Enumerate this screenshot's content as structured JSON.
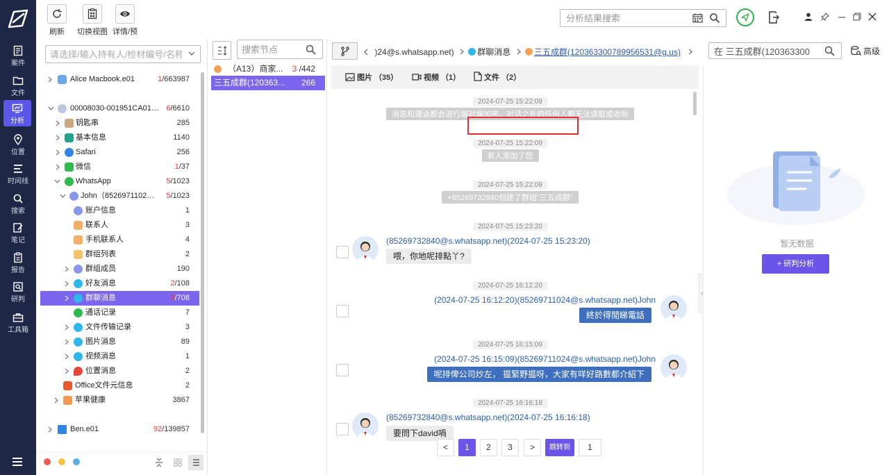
{
  "rail": {
    "items": [
      {
        "label": "案件"
      },
      {
        "label": "文件"
      },
      {
        "label": "分析"
      },
      {
        "label": "位置"
      },
      {
        "label": "时间线"
      },
      {
        "label": "搜索"
      },
      {
        "label": "笔记"
      },
      {
        "label": "报告"
      },
      {
        "label": "研判"
      },
      {
        "label": "工具箱"
      }
    ],
    "active_index": 2
  },
  "toolbar": {
    "refresh_label": "刷新",
    "switch_view_label": "切换视图",
    "details_label": "详情/预览",
    "search_placeholder": "分析结果搜索"
  },
  "tree": {
    "search_placeholder": "请选择/输入持有人/检材编号/名称",
    "rows": [
      {
        "label": "Alice Macbook.e01",
        "cnt_red": "1",
        "cnt": "/663987"
      },
      {
        "label": "00008030-001951CA0130...",
        "cnt_red": "6",
        "cnt": "/6610"
      },
      {
        "label": "钥匙串",
        "cnt": "285"
      },
      {
        "label": "基本信息",
        "cnt": "1140"
      },
      {
        "label": "Safari",
        "cnt": "256"
      },
      {
        "label": "微信",
        "cnt_red": "1",
        "cnt": "/37"
      },
      {
        "label": "WhatsApp",
        "cnt_red": "5",
        "cnt": "/1023"
      },
      {
        "label": "John（85269711024...",
        "cnt_red": "5",
        "cnt": "/1023"
      },
      {
        "label": "账户信息",
        "cnt": "1"
      },
      {
        "label": "联系人",
        "cnt": "3"
      },
      {
        "label": "手机联系人",
        "cnt": "4"
      },
      {
        "label": "群组列表",
        "cnt": "2"
      },
      {
        "label": "群组成员",
        "cnt": "190"
      },
      {
        "label": "好友消息",
        "cnt_red": "2",
        "cnt": "/108"
      },
      {
        "label": "群聊消息",
        "cnt_red": "3",
        "cnt": "/708"
      },
      {
        "label": "通话记录",
        "cnt": "7"
      },
      {
        "label": "文件传输记录",
        "cnt": "3"
      },
      {
        "label": "图片消息",
        "cnt": "89"
      },
      {
        "label": "视频消息",
        "cnt": "1"
      },
      {
        "label": "位置消息",
        "cnt": "2"
      },
      {
        "label": "Office文件元信息",
        "cnt": "2"
      },
      {
        "label": "苹果健康",
        "cnt": "3867"
      },
      {
        "label": "Ben.e01",
        "cnt_red": "92",
        "cnt": "/139857"
      }
    ]
  },
  "nodes": {
    "search_placeholder": "搜索节点",
    "items": [
      {
        "label": "（A13）商家...",
        "cnt_red": "3",
        "cnt": "/442"
      },
      {
        "label": "三五成群(120363...",
        "cnt": "266"
      }
    ]
  },
  "breadcrumb": {
    "part1": ")24@s.whatsapp.net)",
    "part2": "群聊消息",
    "part3": "三五成群(120363300789956531@g.us)"
  },
  "msg_search_value": "在 三五成群(120363300",
  "advanced_label": "高级",
  "media_tabs": [
    {
      "label": "图片 （35）"
    },
    {
      "label": "视频 （1）"
    },
    {
      "label": "文件 （2）"
    }
  ],
  "chat": {
    "ts1": "2024-07-25 15:22:09",
    "sys1": "消息和通话都会进行端对端加密。对话之外的任何人都无法读取或收听",
    "ts2": "2024-07-25 15:22:09",
    "sys2": "有人添加了您",
    "ts3": "2024-07-25 15:22:09",
    "sys3": "+85269732840创建了群组\"三五成群\"",
    "ts4": "2024-07-25 15:23:20",
    "m1_sender": "(85269732840@s.whatsapp.net)(2024-07-25 15:23:20)",
    "m1_text": "喂，你地呢排點丫?",
    "ts5": "2024-07-25 16:12:20",
    "m2_sender": "(2024-07-25 16:12:20)(85269711024@s.whatsapp.net)John",
    "m2_text": "終於得閒睇電話",
    "ts6": "2024-07-25 16:15:09",
    "m3_sender": "(2024-07-25 16:15:09)(85269711024@s.whatsapp.net)John",
    "m3_text": "呢排俾公司炒左， 揾緊野揾呀，大家有咩好路數都介紹下",
    "ts7": "2024-07-25 16:16:18",
    "m4_sender": "(85269732840@s.whatsapp.net)(2024-07-25 16:16:18)",
    "m4_text": "要問下david喎"
  },
  "pager": {
    "prev": "<",
    "pages": [
      "1",
      "2",
      "3"
    ],
    "current": "1",
    "next": ">",
    "jump_label": "跳转到",
    "jump_value": "1"
  },
  "analysis": {
    "empty_text": "暂无数据",
    "button_label": "+ 研判分析"
  },
  "colors": {
    "rail_bg": "#1e2846",
    "accent": "#6a55e8",
    "bubble_out": "#3e6fbf",
    "highlight_border": "#e52d2d",
    "dot_red": "#ee5a55",
    "dot_yellow": "#f6c343",
    "dot_blue": "#5ab0e6"
  }
}
